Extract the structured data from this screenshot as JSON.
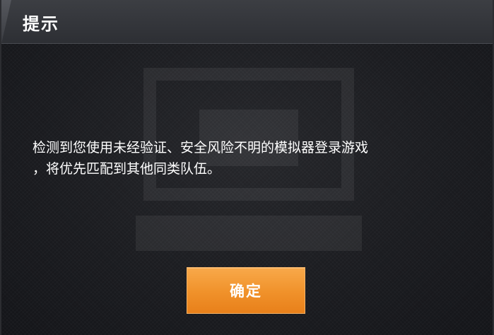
{
  "dialog": {
    "title": "提示",
    "message_line1": "检测到您使用未经验证、安全风险不明的模拟器登录游戏",
    "message_line2": "，将优先匹配到其他同类队伍。",
    "confirm_label": "确定"
  },
  "colors": {
    "button": "#f0912a",
    "header": "#33353a",
    "body": "#1c1d21"
  }
}
